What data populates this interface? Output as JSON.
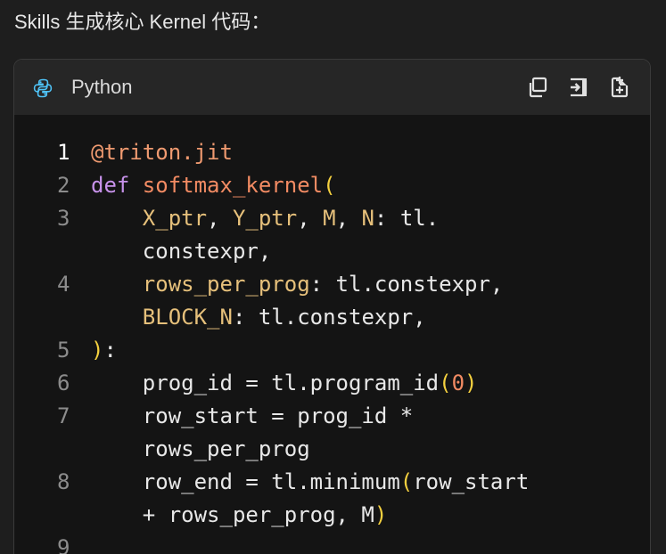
{
  "page": {
    "title": "Skills 生成核心 Kernel 代码："
  },
  "code_block": {
    "language": "Python",
    "toolbar": {
      "copy_icon": "copy-icon",
      "insert_icon": "insert-icon",
      "new_file_icon": "new-file-icon"
    },
    "lines": [
      {
        "number": "1",
        "active": true,
        "segments": [
          {
            "text": "@triton.jit",
            "kind": "dec"
          }
        ]
      },
      {
        "number": "2",
        "segments": [
          {
            "text": "def ",
            "kind": "kw"
          },
          {
            "text": "softmax_kernel",
            "kind": "fn"
          },
          {
            "text": "(",
            "kind": "br"
          }
        ]
      },
      {
        "number": "3",
        "segments": [
          {
            "text": "    ",
            "kind": "pl"
          },
          {
            "text": "X_ptr",
            "kind": "var"
          },
          {
            "text": ", ",
            "kind": "pl"
          },
          {
            "text": "Y_ptr",
            "kind": "var"
          },
          {
            "text": ", ",
            "kind": "pl"
          },
          {
            "text": "M",
            "kind": "var"
          },
          {
            "text": ", ",
            "kind": "pl"
          },
          {
            "text": "N",
            "kind": "var"
          },
          {
            "text": ": tl.",
            "kind": "pl"
          }
        ]
      },
      {
        "number": "",
        "segments": [
          {
            "text": "    constexpr,",
            "kind": "pl"
          }
        ]
      },
      {
        "number": "4",
        "segments": [
          {
            "text": "    ",
            "kind": "pl"
          },
          {
            "text": "rows_per_prog",
            "kind": "var"
          },
          {
            "text": ": tl.constexpr,",
            "kind": "pl"
          }
        ]
      },
      {
        "number": "",
        "segments": [
          {
            "text": "    ",
            "kind": "pl"
          },
          {
            "text": "BLOCK_N",
            "kind": "var"
          },
          {
            "text": ": tl.constexpr,",
            "kind": "pl"
          }
        ]
      },
      {
        "number": "5",
        "segments": [
          {
            "text": ")",
            "kind": "br"
          },
          {
            "text": ":",
            "kind": "pl"
          }
        ]
      },
      {
        "number": "6",
        "segments": [
          {
            "text": "    prog_id = tl.program_id",
            "kind": "pl"
          },
          {
            "text": "(",
            "kind": "br"
          },
          {
            "text": "0",
            "kind": "num"
          },
          {
            "text": ")",
            "kind": "br"
          }
        ]
      },
      {
        "number": "7",
        "segments": [
          {
            "text": "    row_start = prog_id *",
            "kind": "pl"
          }
        ]
      },
      {
        "number": "",
        "segments": [
          {
            "text": "    rows_per_prog",
            "kind": "pl"
          }
        ]
      },
      {
        "number": "8",
        "segments": [
          {
            "text": "    row_end = tl.minimum",
            "kind": "pl"
          },
          {
            "text": "(",
            "kind": "br"
          },
          {
            "text": "row_start",
            "kind": "pl"
          }
        ]
      },
      {
        "number": "",
        "segments": [
          {
            "text": "    + rows_per_prog, M",
            "kind": "pl"
          },
          {
            "text": ")",
            "kind": "br"
          }
        ]
      },
      {
        "number": "9",
        "segments": []
      }
    ]
  },
  "colors": {
    "background": "#1e1e1e",
    "card": "#141414",
    "header": "#262626",
    "decorator": "#ef9a70",
    "keyword": "#c792ea",
    "function": "#f28b63",
    "bracket": "#f4d03f",
    "variable": "#e6c07b",
    "plain": "#e8e8e8"
  }
}
